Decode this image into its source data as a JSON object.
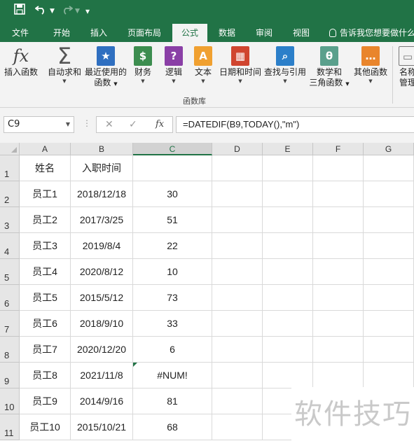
{
  "qat": {
    "save": "save-icon",
    "undo": "undo-icon",
    "redo": "redo-icon",
    "customize": "customize-icon"
  },
  "tabs": [
    "文件",
    "开始",
    "插入",
    "页面布局",
    "公式",
    "数据",
    "审阅",
    "视图"
  ],
  "active_tab": "公式",
  "tell_me": "告诉我您想要做什么",
  "ribbon": {
    "group_label": "函数库",
    "buttons": [
      {
        "icon": "fx",
        "label": "插入函数"
      },
      {
        "icon": "Σ",
        "label": "自动求和"
      },
      {
        "icon": "★",
        "label": "最近使用的",
        "label2": "函数"
      },
      {
        "icon": "$",
        "label": "财务"
      },
      {
        "icon": "?",
        "label": "逻辑"
      },
      {
        "icon": "A",
        "label": "文本"
      },
      {
        "icon": "▦",
        "label": "日期和时间"
      },
      {
        "icon": "⌕",
        "label": "查找与引用"
      },
      {
        "icon": "θ",
        "label": "数学和",
        "label2": "三角函数"
      },
      {
        "icon": "…",
        "label": "其他函数"
      },
      {
        "icon": "▭",
        "label": "名称",
        "label2": "管理"
      }
    ]
  },
  "formula_bar": {
    "name_box": "C9",
    "fx": "fx",
    "formula": "=DATEDIF(B9,TODAY(),\"m\")"
  },
  "columns": [
    "A",
    "B",
    "C",
    "D",
    "E",
    "F",
    "G"
  ],
  "selected_column": "C",
  "rows": [
    {
      "n": "1",
      "a": "姓名",
      "b": "入职时间",
      "c": ""
    },
    {
      "n": "2",
      "a": "员工1",
      "b": "2018/12/18",
      "c": "30"
    },
    {
      "n": "3",
      "a": "员工2",
      "b": "2017/3/25",
      "c": "51"
    },
    {
      "n": "4",
      "a": "员工3",
      "b": "2019/8/4",
      "c": "22"
    },
    {
      "n": "5",
      "a": "员工4",
      "b": "2020/8/12",
      "c": "10"
    },
    {
      "n": "6",
      "a": "员工5",
      "b": "2015/5/12",
      "c": "73"
    },
    {
      "n": "7",
      "a": "员工6",
      "b": "2018/9/10",
      "c": "33"
    },
    {
      "n": "8",
      "a": "员工7",
      "b": "2020/12/20",
      "c": "6"
    },
    {
      "n": "9",
      "a": "员工8",
      "b": "2021/11/8",
      "c": "#NUM!"
    },
    {
      "n": "10",
      "a": "员工9",
      "b": "2014/9/16",
      "c": "81"
    },
    {
      "n": "11",
      "a": "员工10",
      "b": "2015/10/21",
      "c": "68"
    }
  ],
  "watermark": "软件技巧",
  "colors": {
    "excel_green": "#217346"
  }
}
